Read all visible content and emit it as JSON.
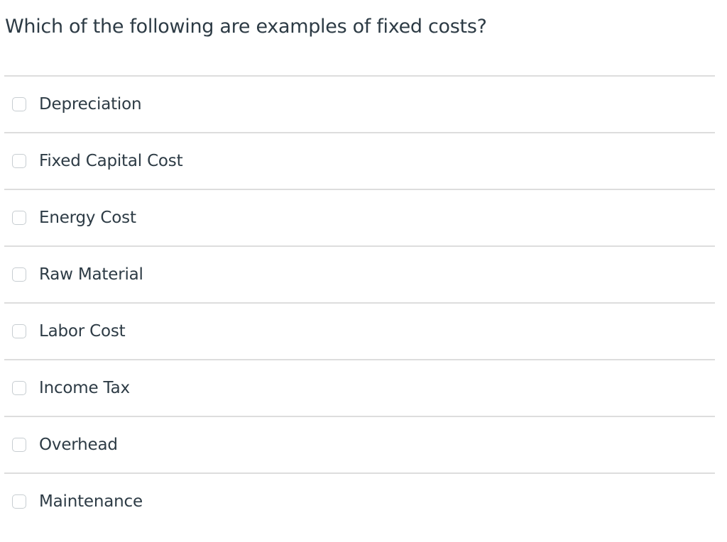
{
  "question": {
    "text": "Which of the following are examples of fixed costs?"
  },
  "answers": [
    {
      "label": "Depreciation",
      "checked": false
    },
    {
      "label": "Fixed Capital Cost",
      "checked": false
    },
    {
      "label": "Energy Cost",
      "checked": false
    },
    {
      "label": "Raw Material",
      "checked": false
    },
    {
      "label": "Labor Cost",
      "checked": false
    },
    {
      "label": "Income Tax",
      "checked": false
    },
    {
      "label": "Overhead",
      "checked": false
    },
    {
      "label": "Maintenance",
      "checked": false
    }
  ],
  "colors": {
    "text": "#2d3b45",
    "divider": "#dddddd",
    "checkbox_border": "#c7cdd1"
  }
}
